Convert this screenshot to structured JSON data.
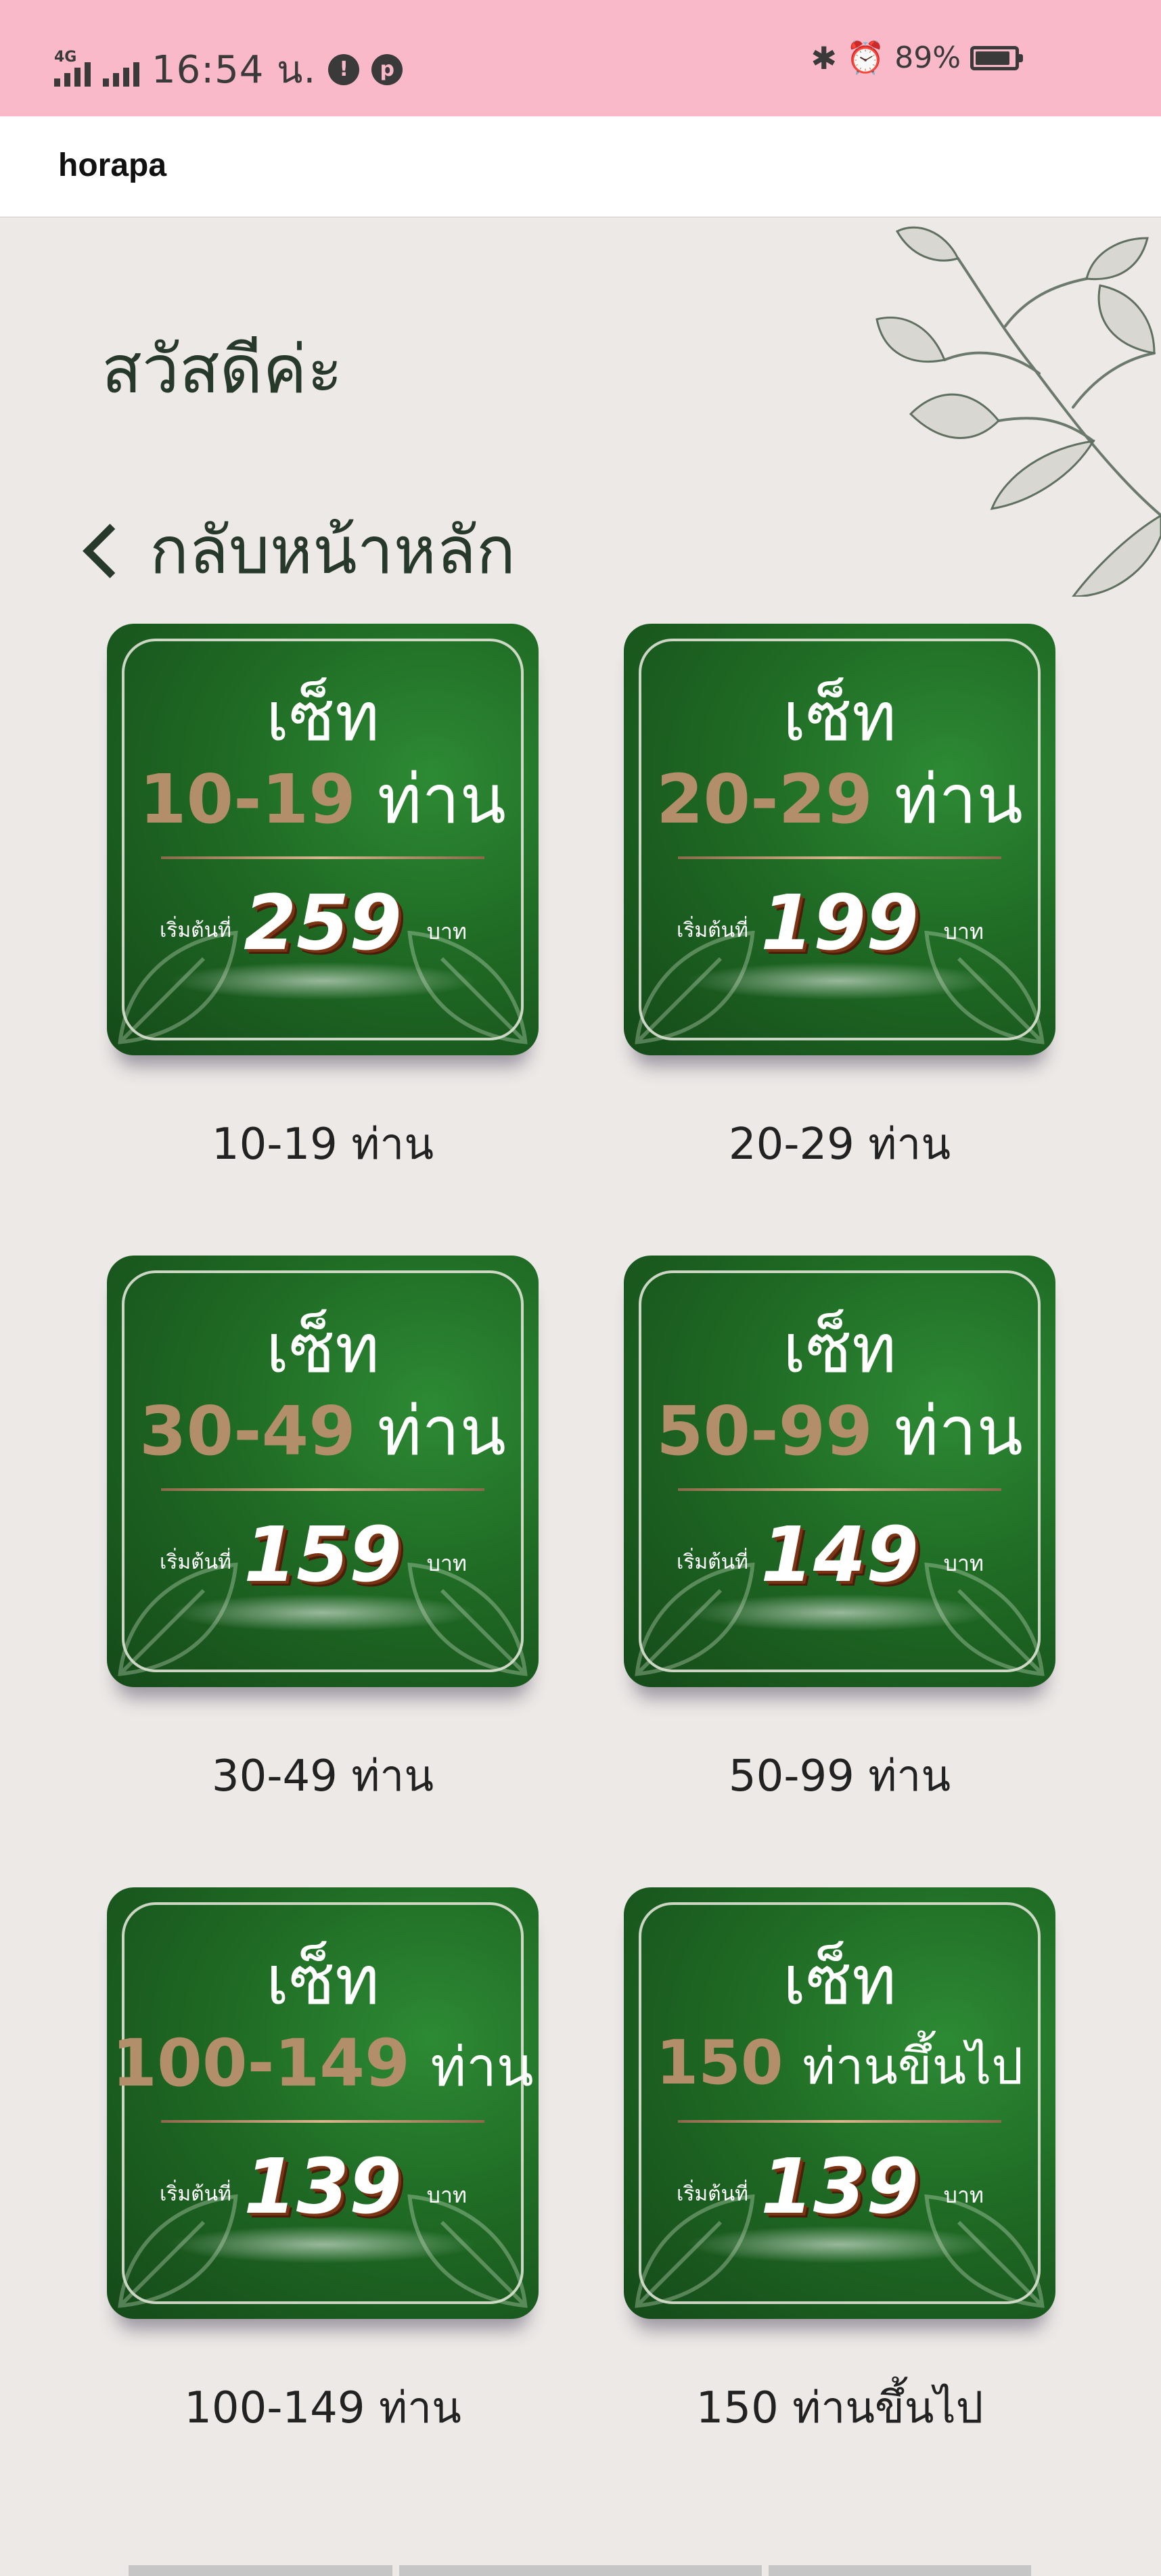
{
  "status_bar": {
    "network": "4G",
    "time": "16:54 น.",
    "battery": "89%",
    "battery_level": 0.89
  },
  "app_bar": {
    "title": "horapa"
  },
  "greeting": "สวัสดีค่ะ",
  "back_link": {
    "label": "กลับหน้าหลัก"
  },
  "packages": [
    {
      "set": "เซ็ท",
      "range": "10-19",
      "unit": "ท่าน",
      "from": "เริ่มต้นที่",
      "price": "259",
      "currency": "บาท",
      "caption": "10-19 ท่าน"
    },
    {
      "set": "เซ็ท",
      "range": "20-29",
      "unit": "ท่าน",
      "from": "เริ่มต้นที่",
      "price": "199",
      "currency": "บาท",
      "caption": "20-29 ท่าน"
    },
    {
      "set": "เซ็ท",
      "range": "30-49",
      "unit": "ท่าน",
      "from": "เริ่มต้นที่",
      "price": "159",
      "currency": "บาท",
      "caption": "30-49 ท่าน"
    },
    {
      "set": "เซ็ท",
      "range": "50-99",
      "unit": "ท่าน",
      "from": "เริ่มต้นที่",
      "price": "149",
      "currency": "บาท",
      "caption": "50-99 ท่าน"
    },
    {
      "set": "เซ็ท",
      "range": "100-149",
      "unit": "ท่าน",
      "from": "เริ่มต้นที่",
      "price": "139",
      "currency": "บาท",
      "caption": "100-149 ท่าน"
    },
    {
      "set": "เซ็ท",
      "range": "150",
      "unit": "ท่านขึ้นไป",
      "from": "เริ่มต้นที่",
      "price": "139",
      "currency": "บาท",
      "caption": "150 ท่านขึ้นไป"
    }
  ],
  "colors": {
    "status_bar": "#f9b9c9",
    "background": "#ede9e6",
    "card_green": "#1f6a24",
    "range_gold": "#b38e6a",
    "heading": "#27392b"
  },
  "icons": {
    "signal": "signal-bars-icon",
    "alert": "alert-circle-icon",
    "pinterest": "pinterest-icon",
    "bluetooth": "bluetooth-icon",
    "alarm": "alarm-clock-icon",
    "battery": "battery-icon",
    "back": "chevron-left-icon",
    "decoration": "leaf-branch-illustration"
  }
}
